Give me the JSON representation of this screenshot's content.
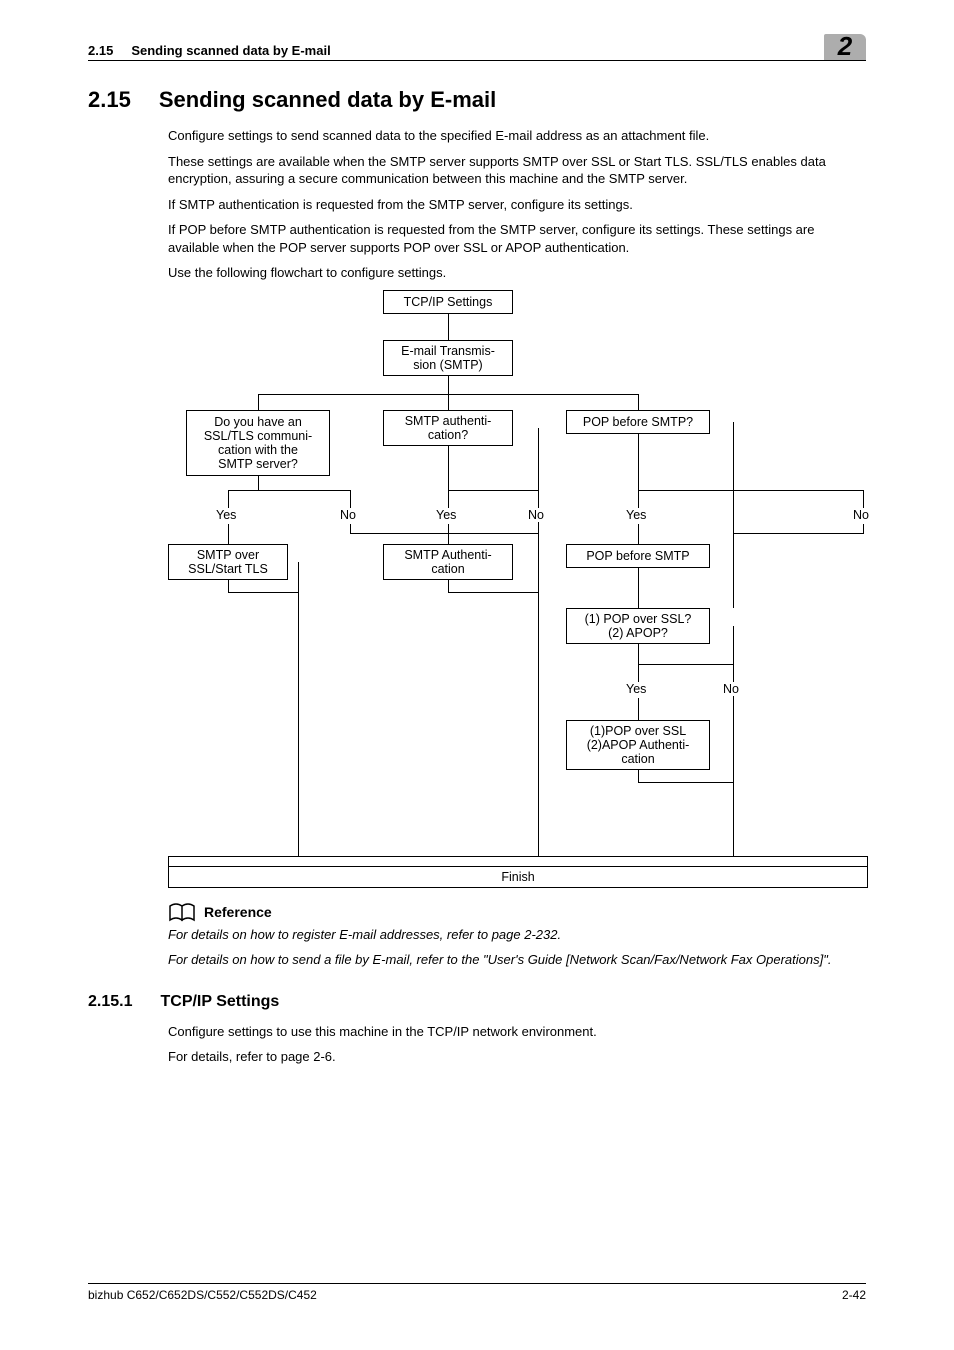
{
  "header": {
    "section_no_small": "2.15",
    "section_title_small": "Sending scanned data by E-mail",
    "chapter_tab": "2"
  },
  "h1": {
    "num": "2.15",
    "title": "Sending scanned data by E-mail"
  },
  "paras": {
    "p1": "Configure settings to send scanned data to the specified E-mail address as an attachment file.",
    "p2": "These settings are available when the SMTP server supports SMTP over SSL or Start TLS. SSL/TLS enables data encryption, assuring a secure communication between this machine and the SMTP server.",
    "p3": "If SMTP authentication is requested from the SMTP server, configure its settings.",
    "p4": "If POP before SMTP authentication is requested from the SMTP server, configure its settings. These settings are available when the POP server supports POP over SSL or APOP authentication.",
    "p5": "Use the following flowchart to configure settings."
  },
  "diagram": {
    "n_tcpip": "TCP/IP Settings",
    "n_email_l1": "E-mail Transmis-",
    "n_email_l2": "sion (SMTP)",
    "q1_l1": "Do you have an",
    "q1_l2": "SSL/TLS communi-",
    "q1_l3": "cation with the",
    "q1_l4": "SMTP server?",
    "q2_l1": "SMTP authenti-",
    "q2_l2": "cation?",
    "q3": "POP before SMTP?",
    "yes": "Yes",
    "no": "No",
    "a1_l1": "SMTP over",
    "a1_l2": "SSL/Start TLS",
    "a2_l1": "SMTP Authenti-",
    "a2_l2": "cation",
    "a3": "POP before SMTP",
    "q4_l1": "(1) POP over SSL?",
    "q4_l2": "(2) APOP?",
    "a4_l1": "(1)POP over SSL",
    "a4_l2": "(2)APOP Authenti-",
    "a4_l3": "cation",
    "finish": "Finish"
  },
  "reference": {
    "heading": "Reference",
    "r1": "For details on how to register E-mail addresses, refer to page 2-232.",
    "r2": "For details on how to send a file by E-mail, refer to the \"User's Guide [Network Scan/Fax/Network Fax Operations]\"."
  },
  "h2": {
    "num": "2.15.1",
    "title": "TCP/IP Settings"
  },
  "sub_paras": {
    "s1": "Configure settings to use this machine in the TCP/IP network environment.",
    "s2": "For details, refer to page 2-6."
  },
  "footer": {
    "left": "bizhub C652/C652DS/C552/C552DS/C452",
    "right": "2-42"
  }
}
